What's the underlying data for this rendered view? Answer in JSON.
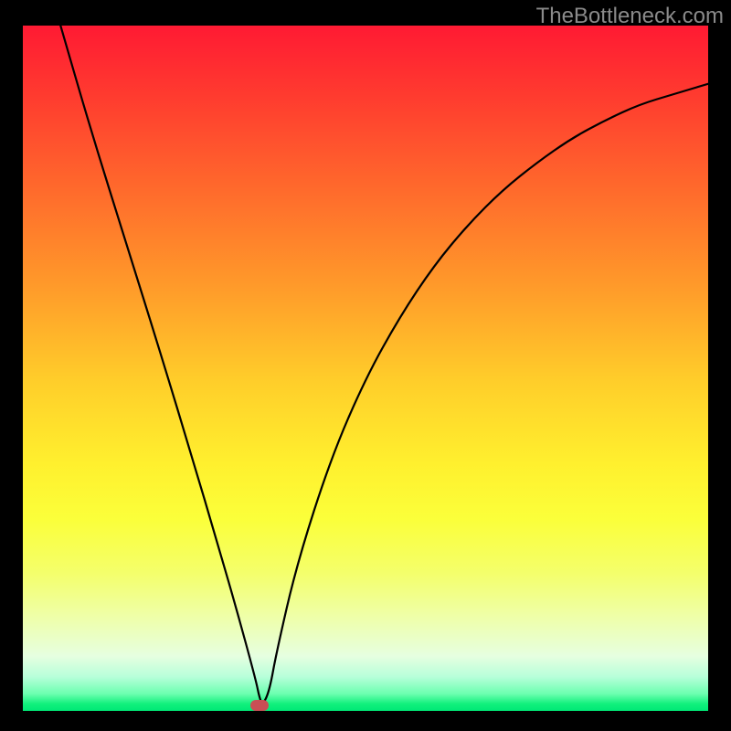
{
  "watermark": "TheBottleneck.com",
  "chart_data": {
    "type": "line",
    "title": "",
    "xlabel": "",
    "ylabel": "",
    "xlim": [
      0,
      1
    ],
    "ylim": [
      0,
      1
    ],
    "grid": false,
    "background_gradient": [
      "#ff1a33",
      "#ff6a2c",
      "#ffce2a",
      "#fbff3a",
      "#efffa6",
      "#6cffb0",
      "#00e876"
    ],
    "series": [
      {
        "name": "curve",
        "color": "#000000",
        "x": [
          0.055,
          0.1,
          0.15,
          0.2,
          0.25,
          0.28,
          0.31,
          0.34,
          0.345,
          0.35,
          0.36,
          0.37,
          0.4,
          0.45,
          0.5,
          0.55,
          0.6,
          0.65,
          0.7,
          0.75,
          0.8,
          0.85,
          0.9,
          0.95,
          1.0
        ],
        "y": [
          1.0,
          0.845,
          0.685,
          0.525,
          0.36,
          0.258,
          0.155,
          0.045,
          0.02,
          0.008,
          0.03,
          0.085,
          0.215,
          0.37,
          0.485,
          0.575,
          0.65,
          0.71,
          0.76,
          0.8,
          0.835,
          0.862,
          0.885,
          0.9,
          0.915
        ]
      }
    ],
    "marker": {
      "x": 0.345,
      "y": 0.008,
      "color": "#c94f55"
    }
  }
}
